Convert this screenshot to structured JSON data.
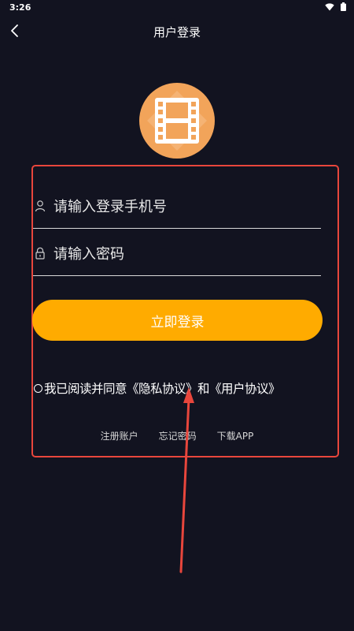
{
  "status_bar": {
    "time": "3:26"
  },
  "header": {
    "title": "用户登录"
  },
  "form": {
    "phone_placeholder": "请输入登录手机号",
    "password_placeholder": "请输入密码",
    "login_button": "立即登录",
    "agreement": {
      "prefix": "我已阅读并同意",
      "privacy_link": "《隐私协议》",
      "conjunction": "和",
      "user_link": "《用户协议》"
    }
  },
  "links": {
    "register": "注册账户",
    "forgot_password": "忘记密码",
    "download_app": "下载APP"
  },
  "colors": {
    "background": "#121320",
    "accent": "#ffab00",
    "logo": "#f2a45a",
    "annotation": "#e8463c"
  },
  "icons": {
    "back": "chevron-left-icon",
    "logo": "film-icon",
    "phone_field": "user-icon",
    "password_field": "lock-icon"
  }
}
